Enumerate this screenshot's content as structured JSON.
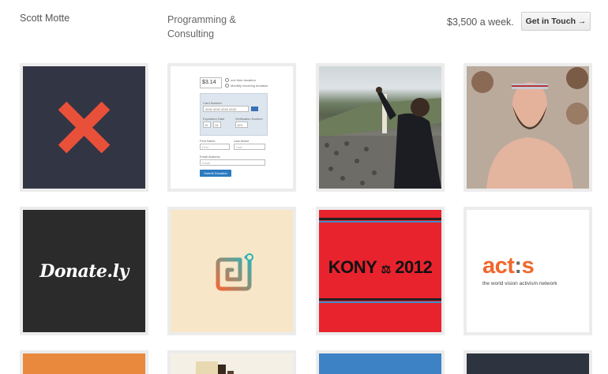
{
  "header": {
    "name": "Scott Motte",
    "tagline": "Programming & Consulting",
    "rate": "$3,500 a week.",
    "cta_label": "Get in Touch →"
  },
  "colors": {
    "x_tile_bg": "#323544",
    "x_mark": "#e8503a",
    "donate_bg": "#2c2b2b",
    "app_bg": "#f7e6c7",
    "kony_bg": "#e8232e",
    "acts_orange": "#f0682c",
    "row3": [
      "#e8893d",
      "#f5f0e6",
      "#3d82c4",
      "#2d3440"
    ]
  },
  "tiles": {
    "form": {
      "amount": "$3.14",
      "option_1": "one time donation",
      "option_2": "Monthly recurring donation",
      "card_number_label": "Card Number",
      "card_number": "4242 4242 4242 4242",
      "expiration_label": "Expiration Date",
      "exp_month": "12",
      "exp_year": "14",
      "verification_label": "Verification Number",
      "cvc": "123",
      "first_name_label": "First Name",
      "first_name_placeholder": "First",
      "last_name_label": "Last Name",
      "last_name_placeholder": "Last",
      "email_label": "Email Address",
      "email_placeholder": "Email",
      "submit_label": "Submit Donation"
    },
    "donately": {
      "logo_text": "Donate.ly"
    },
    "kony": {
      "text_left": "KONY",
      "text_right": "2012"
    },
    "acts": {
      "logo_main": "act",
      "logo_colon": ":",
      "logo_end": "s",
      "subtitle": "the world vision activism network"
    }
  }
}
